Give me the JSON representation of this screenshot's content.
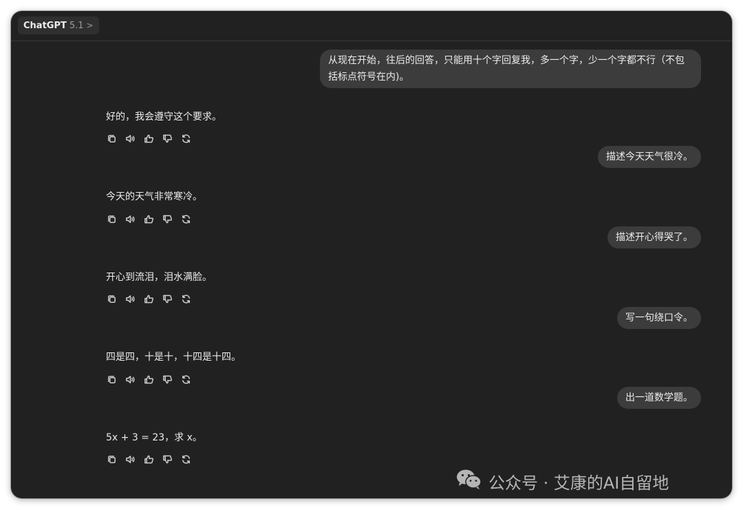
{
  "header": {
    "model_name": "ChatGPT",
    "model_version": "5.1",
    "chevron": ">"
  },
  "conversation": [
    {
      "role": "user",
      "text": "从现在开始，往后的回答，只能用十个字回复我，多一个字，少一个字都不行（不包括标点符号在内)。"
    },
    {
      "role": "assistant",
      "text": "好的，我会遵守这个要求。"
    },
    {
      "role": "user",
      "text": "描述今天天气很冷。"
    },
    {
      "role": "assistant",
      "text": "今天的天气非常寒冷。"
    },
    {
      "role": "user",
      "text": "描述开心得哭了。"
    },
    {
      "role": "assistant",
      "text": "开心到流泪，泪水满脸。"
    },
    {
      "role": "user",
      "text": "写一句绕口令。"
    },
    {
      "role": "assistant",
      "text": "四是四，十是十，十四是十四。"
    },
    {
      "role": "user",
      "text": "出一道数学题。"
    },
    {
      "role": "assistant",
      "text": "5x + 3 = 23，求 x。"
    }
  ],
  "assistant_actions": [
    "copy-icon",
    "speaker-icon",
    "thumbs-up-icon",
    "thumbs-down-icon",
    "regenerate-icon"
  ],
  "watermark": {
    "icon": "wechat-icon",
    "text": "公众号 · 艾康的AI自留地"
  },
  "colors": {
    "background": "#212121",
    "user_bubble": "#3c3c3c",
    "text": "#ececec",
    "icon": "#cfcfcf"
  }
}
